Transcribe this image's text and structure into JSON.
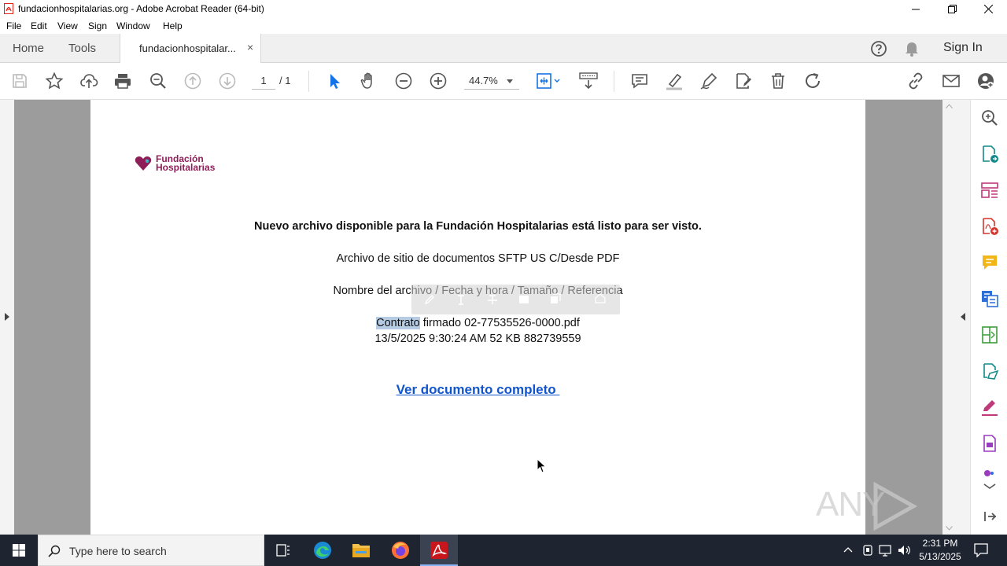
{
  "window": {
    "title": "fundacionhospitalarias.org - Adobe Acrobat Reader (64-bit)"
  },
  "menu": [
    "File",
    "Edit",
    "View",
    "Sign",
    "Window",
    "Help"
  ],
  "tabs": {
    "home": "Home",
    "tools": "Tools",
    "document": "fundacionhospitalar...",
    "close_glyph": "×",
    "sign_in": "Sign In"
  },
  "toolbar": {
    "page_current": "1",
    "page_total": "/ 1",
    "zoom": "44.7%"
  },
  "document": {
    "logo_line1": "Fundación",
    "logo_line2": "Hospitalarias",
    "heading": "Nuevo archivo disponible para la Fundación Hospitalarias está listo para ser visto.",
    "line1": "Archivo de sitio de documentos SFTP US C/Desde PDF",
    "line2": "Nombre del archivo / Fecha y hora / Tamaño / Referencia",
    "file_selected": "Contrato",
    "file_rest": " firmado 02-77535526-0000.pdf",
    "file_meta": "13/5/2025 9:30:24 AM 52 KB 882739559",
    "link": "Ver documento completo "
  },
  "watermark": "ANY RUN",
  "taskbar": {
    "search_placeholder": "Type here to search",
    "time": "2:31 PM",
    "date": "5/13/2025"
  },
  "colors": {
    "acrobat_red": "#e2231a",
    "link_blue": "#1155cc",
    "logo_magenta": "#8e1e57",
    "selection": "#b6cbe4",
    "taskbar": "#1f2530"
  }
}
